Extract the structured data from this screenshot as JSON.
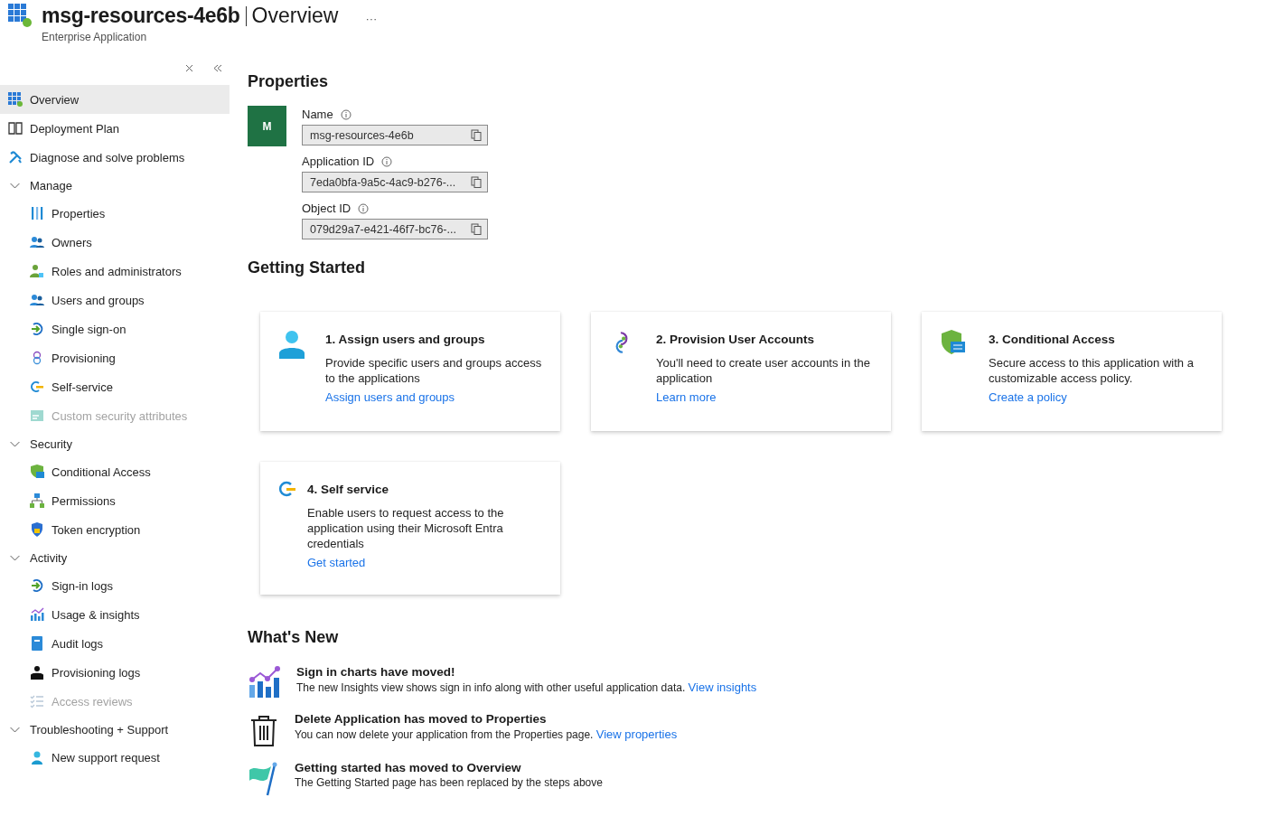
{
  "header": {
    "title": "msg-resources-4e6b",
    "page": "Overview",
    "subtitle": "Enterprise Application",
    "more": "···"
  },
  "nav": [
    {
      "kind": "item",
      "label": "Overview",
      "selected": true,
      "disabled": false
    },
    {
      "kind": "item",
      "label": "Deployment Plan",
      "selected": false,
      "disabled": false
    },
    {
      "kind": "item",
      "label": "Diagnose and solve problems",
      "selected": false,
      "disabled": false
    },
    {
      "kind": "group",
      "label": "Manage",
      "expanded": true,
      "children": [
        {
          "label": "Properties",
          "selected": false,
          "disabled": false
        },
        {
          "label": "Owners",
          "selected": false,
          "disabled": false
        },
        {
          "label": "Roles and administrators",
          "selected": false,
          "disabled": false
        },
        {
          "label": "Users and groups",
          "selected": false,
          "disabled": false
        },
        {
          "label": "Single sign-on",
          "selected": false,
          "disabled": false
        },
        {
          "label": "Provisioning",
          "selected": false,
          "disabled": false
        },
        {
          "label": "Self-service",
          "selected": false,
          "disabled": false
        },
        {
          "label": "Custom security attributes",
          "selected": false,
          "disabled": true
        }
      ]
    },
    {
      "kind": "group",
      "label": "Security",
      "expanded": true,
      "children": [
        {
          "label": "Conditional Access",
          "selected": false,
          "disabled": false
        },
        {
          "label": "Permissions",
          "selected": false,
          "disabled": false
        },
        {
          "label": "Token encryption",
          "selected": false,
          "disabled": false
        }
      ]
    },
    {
      "kind": "group",
      "label": "Activity",
      "expanded": true,
      "children": [
        {
          "label": "Sign-in logs",
          "selected": false,
          "disabled": false
        },
        {
          "label": "Usage & insights",
          "selected": false,
          "disabled": false
        },
        {
          "label": "Audit logs",
          "selected": false,
          "disabled": false
        },
        {
          "label": "Provisioning logs",
          "selected": false,
          "disabled": false
        },
        {
          "label": "Access reviews",
          "selected": false,
          "disabled": true
        }
      ]
    },
    {
      "kind": "group",
      "label": "Troubleshooting + Support",
      "expanded": true,
      "children": [
        {
          "label": "New support request",
          "selected": false,
          "disabled": false
        }
      ]
    }
  ],
  "properties": {
    "heading": "Properties",
    "avatar": "M",
    "fields": [
      {
        "label": "Name",
        "value": "msg-resources-4e6b"
      },
      {
        "label": "Application ID",
        "value": "7eda0bfa-9a5c-4ac9-b276-..."
      },
      {
        "label": "Object ID",
        "value": "079d29a7-e421-46f7-bc76-..."
      }
    ]
  },
  "getting_started": {
    "heading": "Getting Started",
    "cards": [
      {
        "title": "1. Assign users and groups",
        "description": "Provide specific users and groups access to the applications",
        "link": "Assign users and groups"
      },
      {
        "title": "2. Provision User Accounts",
        "description": "You'll need to create user accounts in the application",
        "link": "Learn more"
      },
      {
        "title": "3. Conditional Access",
        "description": "Secure access to this application with a customizable access policy.",
        "link": "Create a policy"
      },
      {
        "title": "4. Self service",
        "description": "Enable users to request access to the application using their Microsoft Entra credentials",
        "link": "Get started"
      }
    ]
  },
  "whats_new": {
    "heading": "What's New",
    "items": [
      {
        "title": "Sign in charts have moved!",
        "description": "The new Insights view shows sign in info along with other useful application data.",
        "link": "View insights"
      },
      {
        "title": "Delete Application has moved to Properties",
        "description": "You can now delete your application from the Properties page.",
        "link": "View properties"
      },
      {
        "title": "Getting started has moved to Overview",
        "description": "The Getting Started page has been replaced by the steps above"
      }
    ]
  }
}
